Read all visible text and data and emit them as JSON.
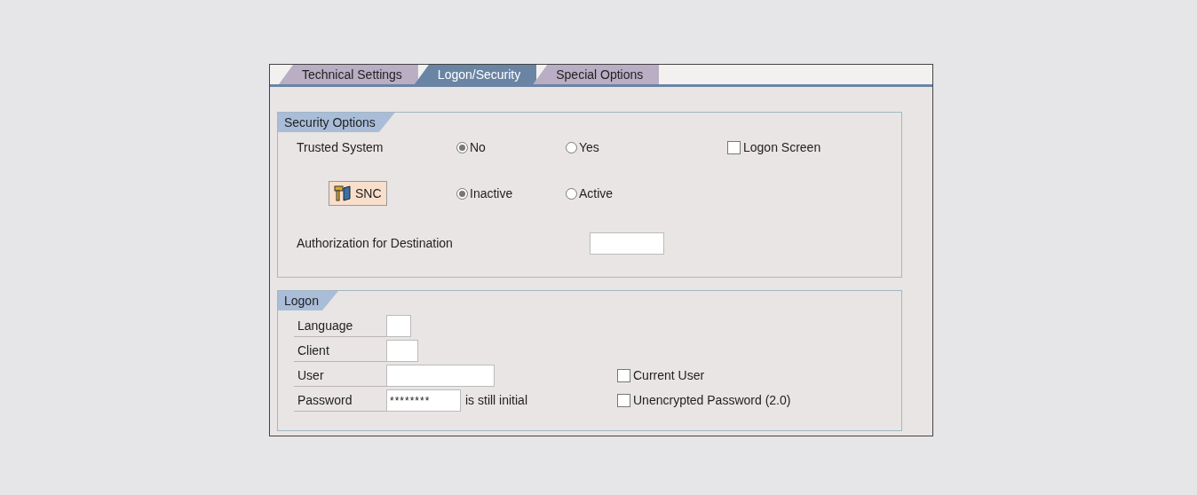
{
  "tabs": [
    {
      "label": "Technical Settings",
      "selected": false
    },
    {
      "label": "Logon/Security",
      "selected": true
    },
    {
      "label": "Special Options",
      "selected": false
    }
  ],
  "security_options": {
    "title": "Security Options",
    "trusted_system": {
      "label": "Trusted System",
      "options": [
        {
          "label": "No",
          "selected": true
        },
        {
          "label": "Yes",
          "selected": false
        }
      ]
    },
    "logon_screen": {
      "label": "Logon Screen",
      "checked": false
    },
    "snc": {
      "button": "SNC",
      "options": [
        {
          "label": "Inactive",
          "selected": true
        },
        {
          "label": "Active",
          "selected": false
        }
      ]
    },
    "authorization": {
      "label": "Authorization for Destination"
    }
  },
  "logon": {
    "title": "Logon",
    "fields": [
      {
        "label": "Language"
      },
      {
        "label": "Client"
      },
      {
        "label": "User",
        "option": {
          "label": "Current User",
          "checked": false
        }
      },
      {
        "label": "Password",
        "value": "********",
        "note": "is still initial",
        "option": {
          "label": "Unencrypted Password (2.0)",
          "checked": false
        }
      }
    ]
  }
}
